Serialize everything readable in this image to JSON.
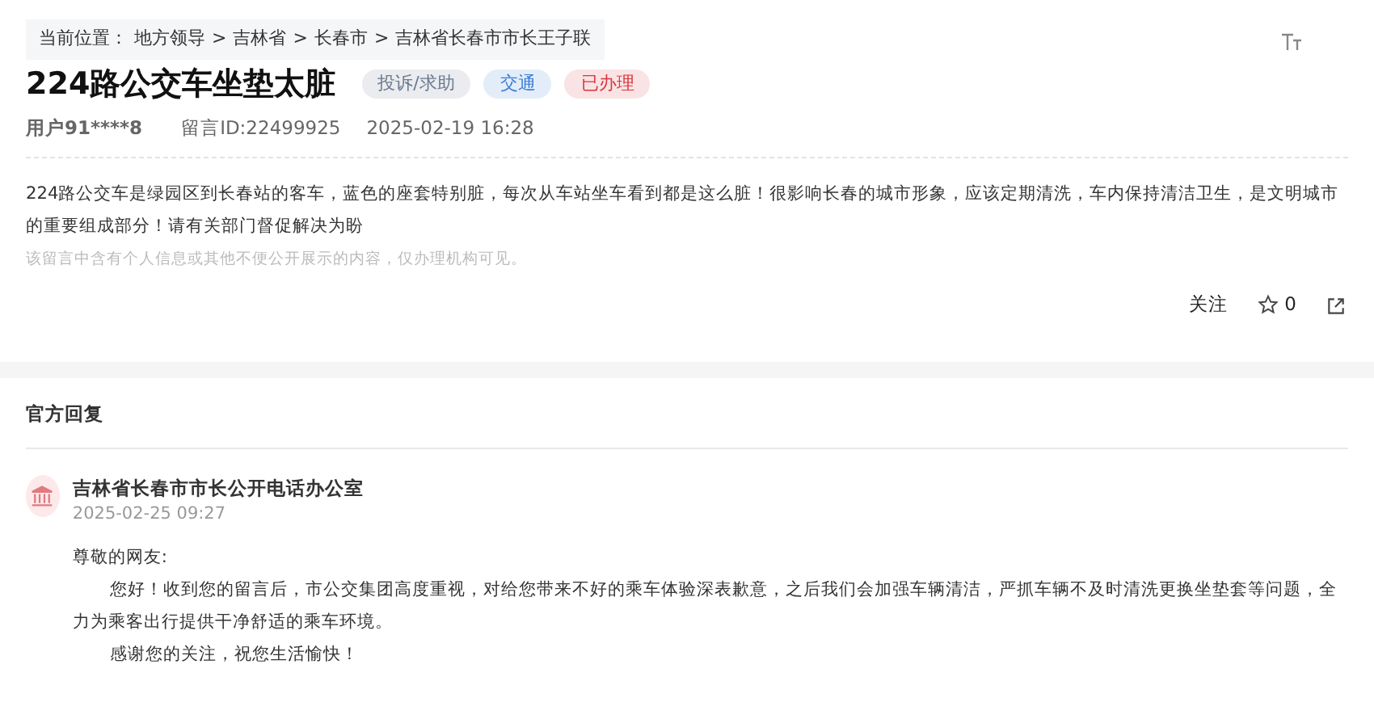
{
  "breadcrumb": {
    "label": "当前位置：",
    "items": [
      "地方领导",
      "吉林省",
      "长春市",
      "吉林省长春市市长王子联"
    ],
    "separator": ">"
  },
  "title": "224路公交车坐垫太脏",
  "tags": [
    {
      "label": "投诉/求助",
      "color": "#6b7a90"
    },
    {
      "label": "交通",
      "color": "#3a7bd5"
    },
    {
      "label": "已办理",
      "color": "#d9363e"
    }
  ],
  "meta": {
    "user": "用户91****8",
    "message_id": "留言ID:22499925",
    "time": "2025-02-19 16:28"
  },
  "body": "224路公交车是绿园区到长春站的客车，蓝色的座套特别脏，每次从车站坐车看到都是这么脏！很影响长春的城市形象，应该定期清洗，车内保持清洁卫生，是文明城市的重要组成部分！请有关部门督促解决为盼",
  "privacy_note": "该留言中含有个人信息或其他不便公开展示的内容，仅办理机构可见。",
  "actions": {
    "follow": "关注",
    "likes": "0"
  },
  "reply": {
    "heading": "官方回复",
    "org": "吉林省长春市市长公开电话办公室",
    "time": "2025-02-25 09:27",
    "paragraphs": [
      {
        "text": "尊敬的网友:",
        "indent": false
      },
      {
        "text": "您好！收到您的留言后，市公交集团高度重视，对给您带来不好的乘车体验深表歉意，之后我们会加强车辆清洁，严抓车辆不及时清洗更换坐垫套等问题，全力为乘客出行提供干净舒适的乘车环境。",
        "indent": true
      },
      {
        "text": "感谢您的关注，祝您生活愉快！",
        "indent": true
      }
    ]
  }
}
